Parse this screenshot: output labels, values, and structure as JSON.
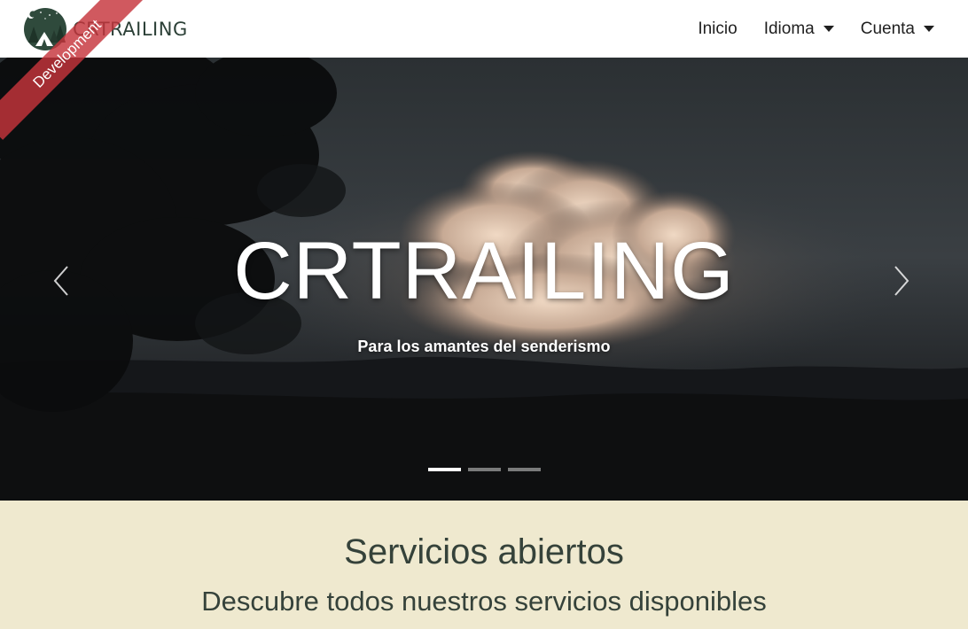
{
  "brand": {
    "name": "CRTRAILING"
  },
  "nav": {
    "home_label": "Inicio",
    "language_label": "Idioma",
    "account_label": "Cuenta"
  },
  "ribbon": {
    "label": "Development"
  },
  "hero": {
    "title": "CRTRAILING",
    "subtitle": "Para los amantes del senderismo",
    "slide_count": 3,
    "active_slide": 1
  },
  "services": {
    "title": "Servicios abiertos",
    "subtitle": "Descubre todos nuestros servicios disponibles"
  },
  "colors": {
    "brand_text": "#2c4037",
    "ribbon": "#c6343c",
    "services_bg": "#efe9cf",
    "services_text": "#35423a"
  }
}
